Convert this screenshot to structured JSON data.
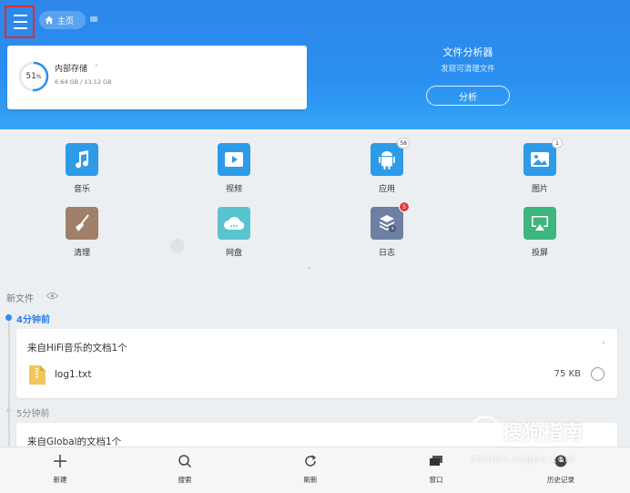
{
  "header": {
    "home_label": "主页",
    "storage": {
      "percent": "51",
      "percent_unit": "%",
      "percent_fraction": 0.51,
      "title": "内部存储",
      "size": "6.64 GB / 13.12 GB"
    },
    "analyzer": {
      "title": "文件分析器",
      "subtitle": "发现可清理文件",
      "button": "分析"
    }
  },
  "categories": [
    {
      "label": "音乐",
      "color": "#2d9be8",
      "icon": "music-note-icon",
      "badge": ""
    },
    {
      "label": "视频",
      "color": "#2d9be8",
      "icon": "video-icon",
      "badge": ""
    },
    {
      "label": "应用",
      "color": "#2d9be8",
      "icon": "android-icon",
      "badge": "58"
    },
    {
      "label": "图片",
      "color": "#2d9be8",
      "icon": "picture-icon",
      "badge": "1"
    },
    {
      "label": "清理",
      "color": "#a1806a",
      "icon": "broom-icon",
      "badge": ""
    },
    {
      "label": "网盘",
      "color": "#5ac3d0",
      "icon": "cloud-icon",
      "badge": ""
    },
    {
      "label": "日志",
      "color": "#6d7fa3",
      "icon": "log-icon",
      "badge": "5"
    },
    {
      "label": "投屏",
      "color": "#3db57e",
      "icon": "cast-icon",
      "badge": ""
    }
  ],
  "recent": {
    "title": "新文件",
    "groups": [
      {
        "time": "4分钟前",
        "title": "来自HiFi音乐的文档1个",
        "file": {
          "name": "log1.txt",
          "size": "75 KB"
        }
      },
      {
        "time": "5分钟前",
        "title": "来自Global的文档1个"
      }
    ]
  },
  "bottombar": [
    {
      "label": "新建",
      "icon": "plus-icon"
    },
    {
      "label": "搜索",
      "icon": "search-icon"
    },
    {
      "label": "刷新",
      "icon": "refresh-icon"
    },
    {
      "label": "窗口",
      "icon": "windows-icon"
    },
    {
      "label": "历史记录",
      "icon": "history-icon"
    }
  ],
  "watermark": {
    "logo": "S",
    "text": "搜狗指南",
    "url": "zhinan.sogou.com"
  },
  "colors": {
    "header": "#2a8ff0",
    "accent": "#2a7ff0",
    "highlight_border": "#e32b2b",
    "badge_red": "#e53935"
  }
}
